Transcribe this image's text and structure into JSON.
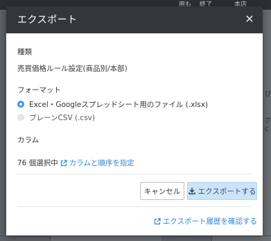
{
  "background": {
    "top_text_1": "用も　 終了",
    "top_text_2": "本店",
    "right_glyphs": [
      "び",
      "さ",
      "C"
    ]
  },
  "dialog": {
    "title": "エクスポート",
    "close_label": "×",
    "type_section": {
      "label": "種類",
      "value": "売買価格ルール設定(商品別/本部)"
    },
    "format_section": {
      "label": "フォーマット",
      "options": [
        {
          "label": "Excel・Googleスプレッドシート用のファイル (.xlsx)",
          "checked": true
        },
        {
          "label": "プレーンCSV (.csv)",
          "checked": false
        }
      ]
    },
    "column_section": {
      "label": "カラム",
      "count_text": "76 個選択中",
      "link_text": "カラムと順序を指定"
    },
    "buttons": {
      "cancel": "キャンセル",
      "export": "エクスポートする"
    },
    "history_link": "エクスポート履歴を確認する"
  },
  "colors": {
    "header_bg": "#33363a",
    "accent": "#3b97e3",
    "link": "#2e86d1",
    "export_button_bg": "#cde3f6"
  }
}
